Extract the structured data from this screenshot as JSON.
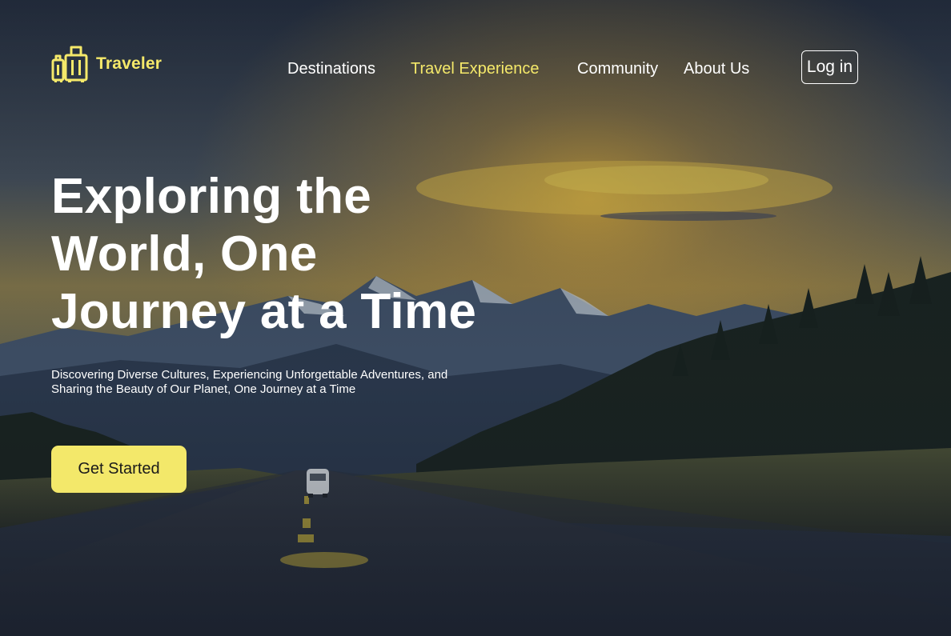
{
  "brand": {
    "name": "Traveler",
    "icon": "luggage-icon",
    "accent_color": "#f5e96a"
  },
  "nav": {
    "items": [
      {
        "label": "Destinations",
        "active": false
      },
      {
        "label": "Travel Experience",
        "active": true
      },
      {
        "label": "Community",
        "active": false
      },
      {
        "label": "About Us",
        "active": false
      }
    ],
    "login_label": "Log in"
  },
  "hero": {
    "title_lines": [
      "Exploring the",
      "World, One",
      "Journey at a Time"
    ],
    "subtitle": "Discovering Diverse Cultures, Experiencing Unforgettable Adventures, and Sharing the Beauty of Our Planet, One Journey at a Time",
    "cta_label": "Get Started",
    "cta_color": "#f3e86a"
  }
}
